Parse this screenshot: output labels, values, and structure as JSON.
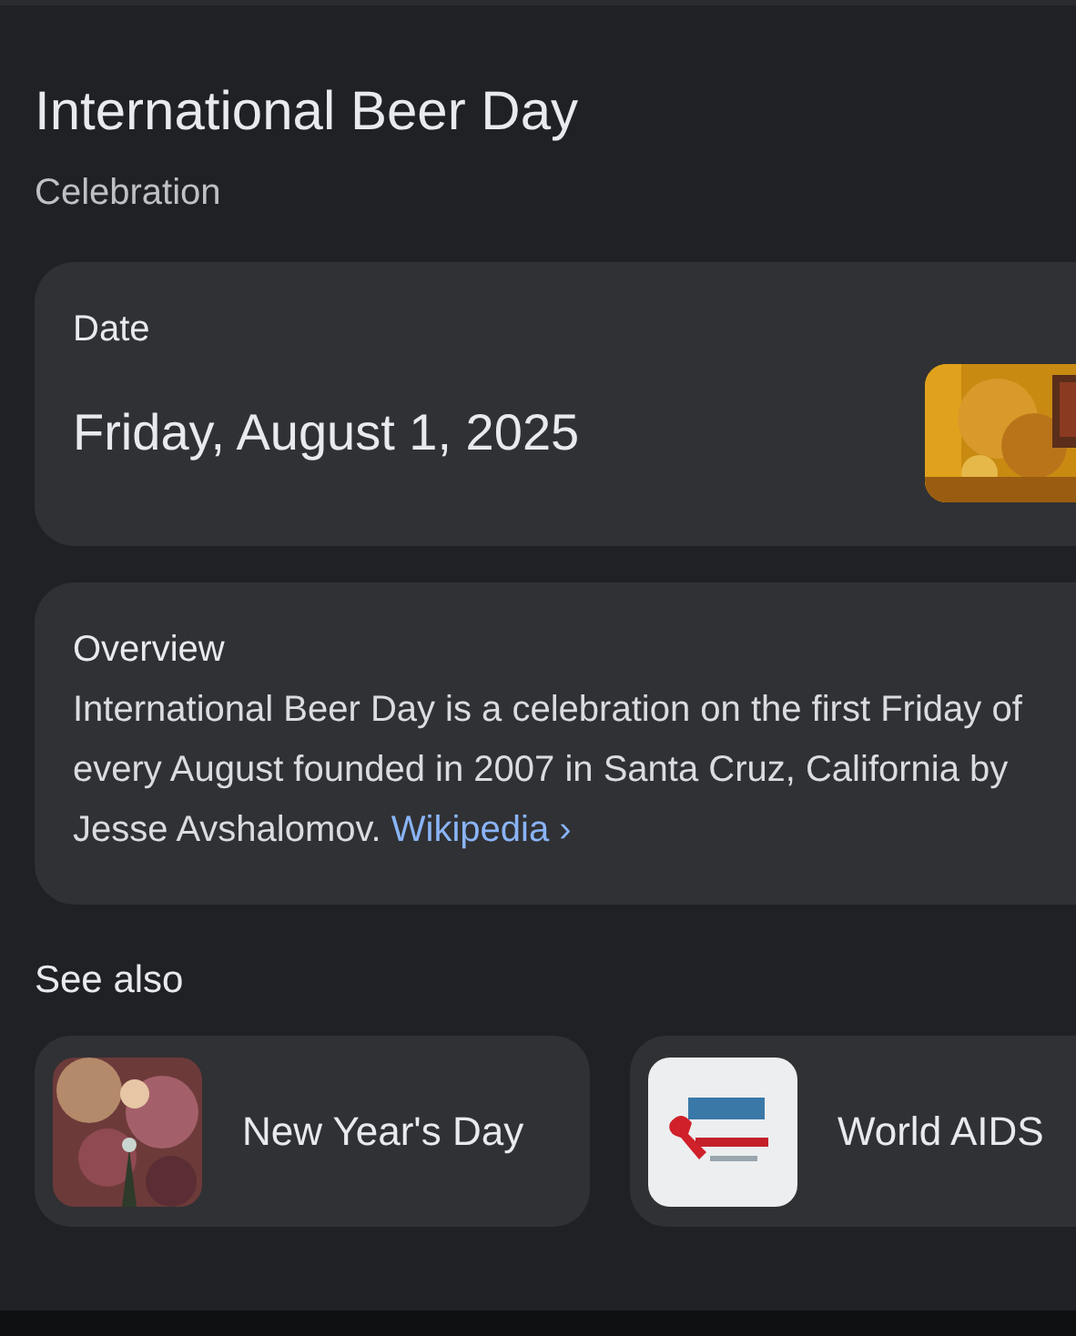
{
  "title": "International Beer Day",
  "subtitle": "Celebration",
  "date_card": {
    "label": "Date",
    "value": "Friday, August 1, 2025"
  },
  "overview": {
    "label": "Overview",
    "text": "International Beer Day is a celebration on the first Friday of every August founded in 2007 in Santa Cruz, California by Jesse Avshalomov.",
    "link": {
      "label": "Wikipedia",
      "arrow": "›"
    }
  },
  "see_also": {
    "heading": "See also",
    "items": [
      {
        "label": "New Year's Day"
      },
      {
        "label": "World AIDS"
      }
    ]
  }
}
